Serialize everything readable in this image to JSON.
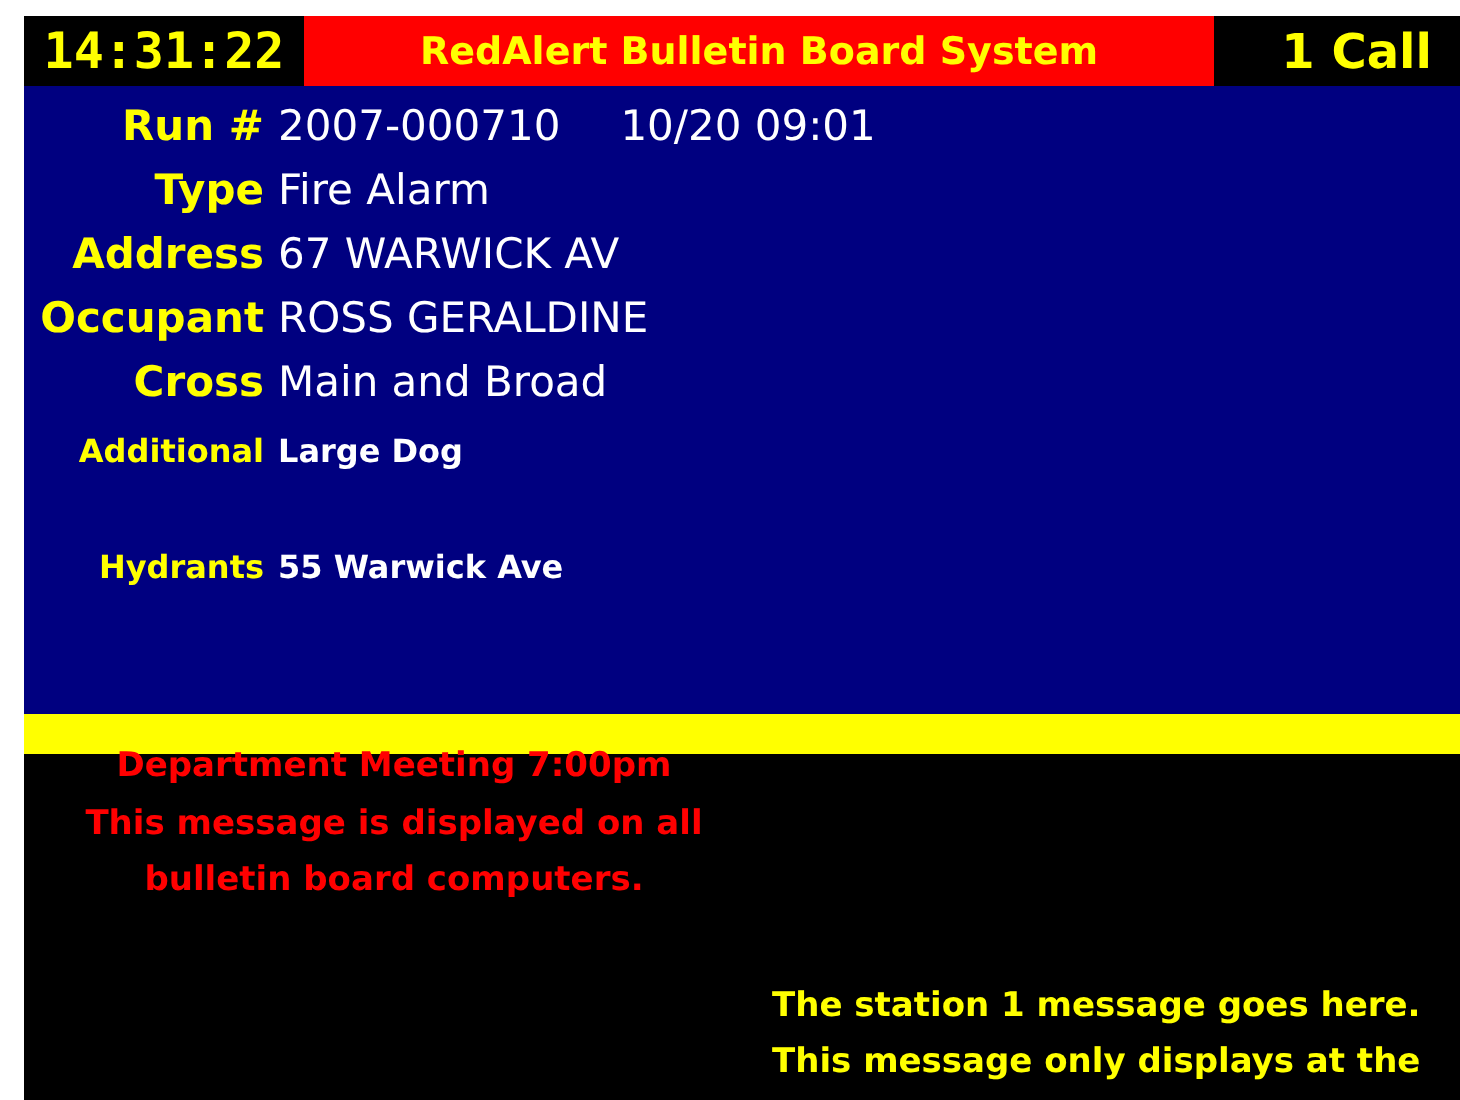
{
  "header": {
    "clock": "14:31:22",
    "title": "RedAlert Bulletin Board System",
    "call_count": "1 Call"
  },
  "fields": [
    {
      "label": "Run #",
      "values": [
        "2007-000710",
        "10/20 09:01"
      ],
      "kind": "large"
    },
    {
      "label": "Type",
      "values": [
        "Fire Alarm"
      ],
      "kind": "large"
    },
    {
      "label": "Address",
      "values": [
        "67 WARWICK AV"
      ],
      "kind": "large"
    },
    {
      "label": "Occupant",
      "values": [
        "ROSS GERALDINE"
      ],
      "kind": "large"
    },
    {
      "label": "Cross",
      "values": [
        "Main and Broad"
      ],
      "kind": "large"
    },
    {
      "label": "Additional",
      "values": [
        "Large Dog"
      ],
      "kind": "small"
    },
    {
      "label": "Hydrants",
      "values": [
        "55 Warwick Ave"
      ],
      "kind": "small"
    }
  ],
  "messages": {
    "department": [
      "Department Meeting 7:00pm",
      "This message is displayed on all",
      "bulletin board computers."
    ],
    "station": [
      "The station 1 message goes here.",
      "This message only displays at the"
    ]
  }
}
